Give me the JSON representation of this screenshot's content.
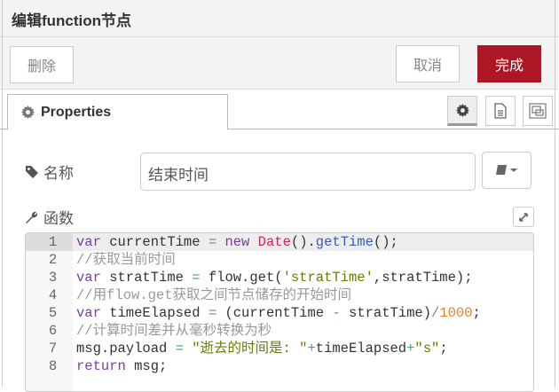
{
  "header": {
    "title": "编辑function节点"
  },
  "toolbar": {
    "delete_label": "删除",
    "cancel_label": "取消",
    "done_label": "完成",
    "accent": "#ad1625"
  },
  "tabs": {
    "properties_label": "Properties",
    "icons": [
      "gear-icon",
      "description-icon",
      "appearance-icon"
    ]
  },
  "form": {
    "name_label": "名称",
    "name_value": "结束时间",
    "function_label": "函数"
  },
  "code": {
    "lines": [
      [
        [
          "kw",
          "var"
        ],
        [
          "plain",
          " currentTime "
        ],
        [
          "op",
          "="
        ],
        [
          "plain",
          " "
        ],
        [
          "kw",
          "new"
        ],
        [
          "plain",
          " "
        ],
        [
          "builtin",
          "Date"
        ],
        [
          "plain",
          "()."
        ],
        [
          "fn",
          "getTime"
        ],
        [
          "plain",
          "();"
        ]
      ],
      [
        [
          "cm",
          "//获取当前时间"
        ]
      ],
      [
        [
          "kw",
          "var"
        ],
        [
          "plain",
          " stratTime "
        ],
        [
          "op",
          "="
        ],
        [
          "plain",
          " flow.get("
        ],
        [
          "str",
          "'stratTime'"
        ],
        [
          "plain",
          ",stratTime);"
        ]
      ],
      [
        [
          "cm",
          "//用flow.get获取之间节点储存的开始时间"
        ]
      ],
      [
        [
          "kw",
          "var"
        ],
        [
          "plain",
          " timeElapsed "
        ],
        [
          "op",
          "="
        ],
        [
          "plain",
          " (currentTime "
        ],
        [
          "op",
          "-"
        ],
        [
          "plain",
          " stratTime)"
        ],
        [
          "op",
          "/"
        ],
        [
          "num",
          "1000"
        ],
        [
          "plain",
          ";"
        ]
      ],
      [
        [
          "cm",
          "//计算时间差并从毫秒转换为秒"
        ]
      ],
      [
        [
          "plain",
          "msg.payload "
        ],
        [
          "op",
          "="
        ],
        [
          "plain",
          " "
        ],
        [
          "str",
          "\"逝去的时间是: \""
        ],
        [
          "op",
          "+"
        ],
        [
          "plain",
          "timeElapsed"
        ],
        [
          "op",
          "+"
        ],
        [
          "str",
          "\"s\""
        ],
        [
          "plain",
          ";"
        ]
      ],
      [
        [
          "kw",
          "return"
        ],
        [
          "plain",
          " msg;"
        ]
      ]
    ]
  }
}
